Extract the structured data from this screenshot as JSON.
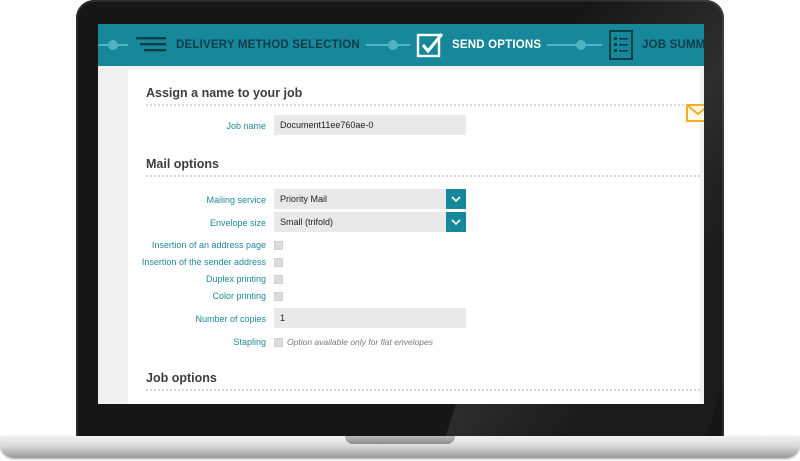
{
  "steps": [
    {
      "label": "DELIVERY METHOD SELECTION",
      "icon": "list-lines-icon",
      "state": "done"
    },
    {
      "label": "SEND OPTIONS",
      "icon": "checkbox-checked-icon",
      "state": "active"
    },
    {
      "label": "JOB SUMM",
      "icon": "checklist-document-icon",
      "state": "upcoming"
    }
  ],
  "sections": {
    "job_name": {
      "title": "Assign a name to your job"
    },
    "mail_options": {
      "title": "Mail options"
    },
    "job_options": {
      "title": "Job options"
    }
  },
  "fields": {
    "job_name": {
      "label": "Job name",
      "value": "Document11ee760ae-0"
    },
    "mailing_service": {
      "label": "Mailing service",
      "value": "Priority Mail"
    },
    "envelope_size": {
      "label": "Envelope size",
      "value": "Small (trifold)"
    },
    "insertion_address_page": {
      "label": "Insertion of an address page",
      "checked": false
    },
    "insertion_sender_address": {
      "label": "Insertion of the sender address",
      "checked": false
    },
    "duplex_printing": {
      "label": "Duplex printing",
      "checked": false
    },
    "color_printing": {
      "label": "Color printing",
      "checked": false
    },
    "number_of_copies": {
      "label": "Number of copies",
      "value": "1"
    },
    "stapling": {
      "label": "Stapling",
      "checked": false,
      "hint": "Option available only for flat envelopes"
    }
  },
  "colors": {
    "accent": "#17889a",
    "label": "#1f8a9b",
    "envelope_icon": "#f2b01e"
  }
}
